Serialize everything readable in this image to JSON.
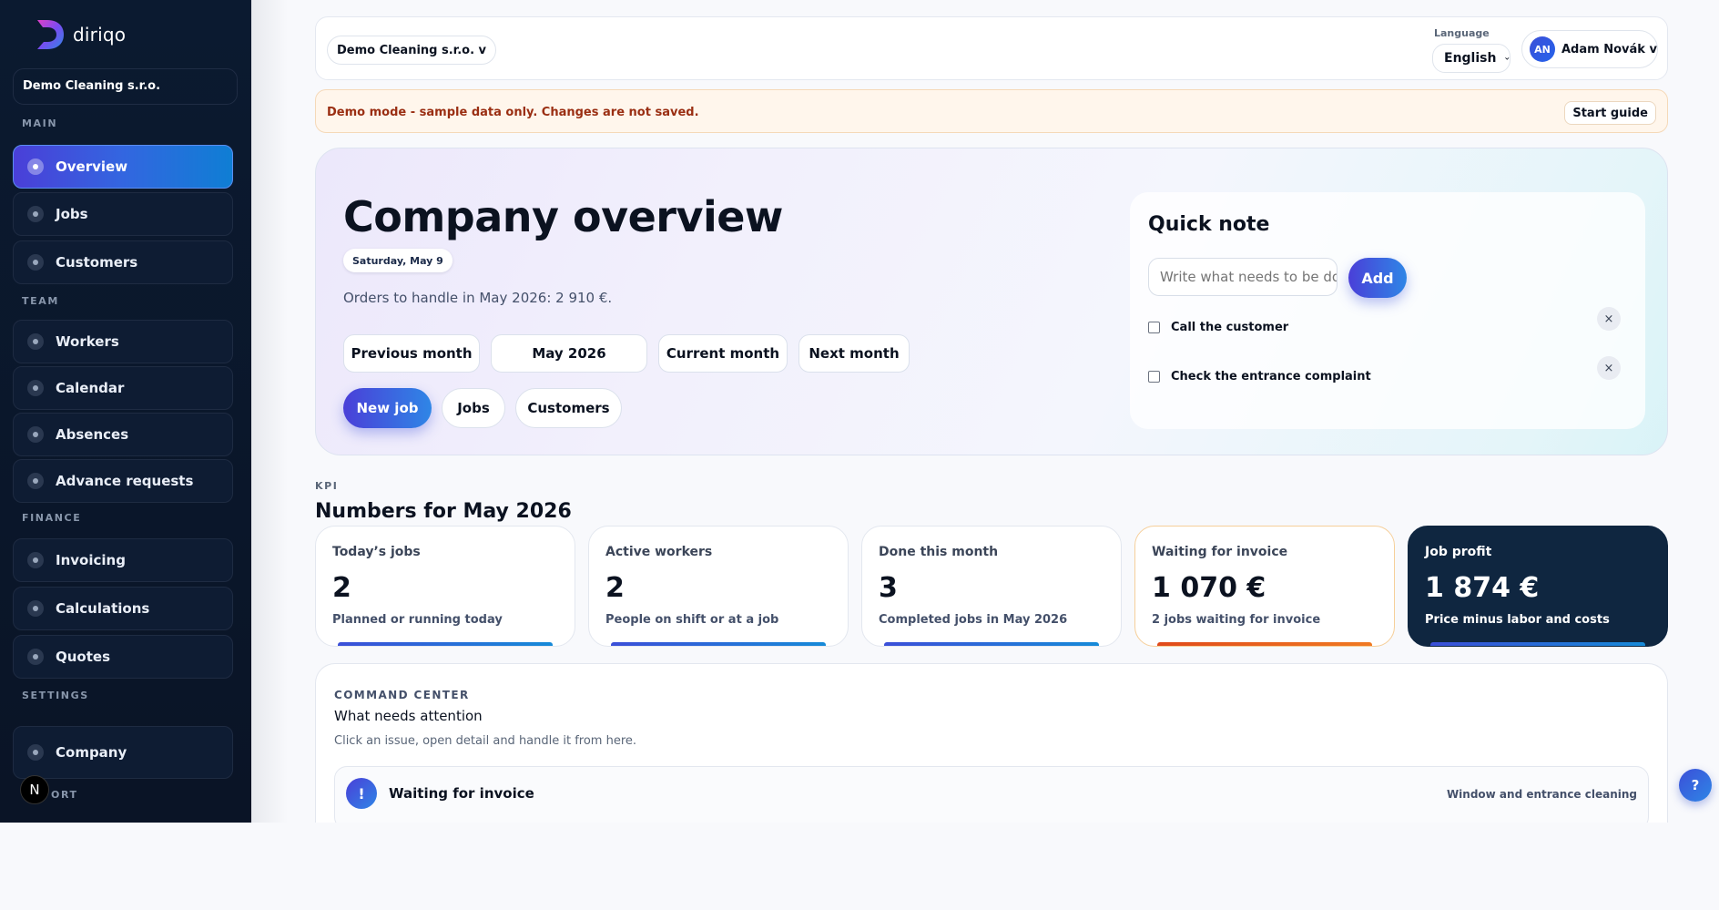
{
  "app": {
    "brand": "diriqo"
  },
  "sidebar": {
    "company": "Demo Cleaning s.r.o.",
    "sections": {
      "main": "MAIN",
      "team": "TEAM",
      "finance": "FINANCE",
      "settings": "SETTINGS",
      "support": "ORT"
    },
    "items": {
      "overview": "Overview",
      "jobs": "Jobs",
      "customers": "Customers",
      "workers": "Workers",
      "calendar": "Calendar",
      "absences": "Absences",
      "advance_requests": "Advance requests",
      "invoicing": "Invoicing",
      "calculations": "Calculations",
      "quotes": "Quotes",
      "company": "Company"
    },
    "next_badge": "N"
  },
  "topbar": {
    "company": "Demo Cleaning s.r.o. v",
    "language_label": "Language",
    "language_value": "English",
    "user_initials": "AN",
    "user_name": "Adam Novák v"
  },
  "banner": {
    "text": "Demo mode - sample data only. Changes are not saved.",
    "button": "Start guide"
  },
  "hero": {
    "title": "Company overview",
    "date": "Saturday, May 9",
    "orders_text": "Orders to handle in May 2026: 2 910 €.",
    "month_buttons": {
      "previous": "Previous month",
      "current_label": "May 2026",
      "current": "Current month",
      "next": "Next month"
    },
    "actions": {
      "new_job": "New job",
      "jobs": "Jobs",
      "customers": "Customers"
    }
  },
  "quick_note": {
    "title": "Quick note",
    "placeholder": "Write what needs to be done",
    "add": "Add",
    "items": [
      "Call the customer",
      "Check the entrance complaint"
    ],
    "remove_glyph": "×"
  },
  "kpi": {
    "label": "KPI",
    "heading": "Numbers for May 2026",
    "cards": [
      {
        "title": "Today’s jobs",
        "value": "2",
        "sub": "Planned or running today"
      },
      {
        "title": "Active workers",
        "value": "2",
        "sub": "People on shift or at a job"
      },
      {
        "title": "Done this month",
        "value": "3",
        "sub": "Completed jobs in May 2026"
      },
      {
        "title": "Waiting for invoice",
        "value": "1 070 €",
        "sub": "2 jobs waiting for invoice"
      },
      {
        "title": "Job profit",
        "value": "1 874 €",
        "sub": "Price minus labor and costs"
      }
    ]
  },
  "command_center": {
    "label": "COMMAND CENTER",
    "title": "What needs attention",
    "subtitle": "Click an issue, open detail and handle it from here.",
    "issue": {
      "icon": "!",
      "title": "Waiting for invoice",
      "detail": "Window and entrance cleaning"
    }
  },
  "help": {
    "glyph": "?"
  },
  "colors": {
    "sidebar_bg": "#0b1a30",
    "accent_start": "#4a3fd8",
    "accent_end": "#2f86e6",
    "warning": "#9a2e12",
    "dark_card": "#0f2640"
  }
}
